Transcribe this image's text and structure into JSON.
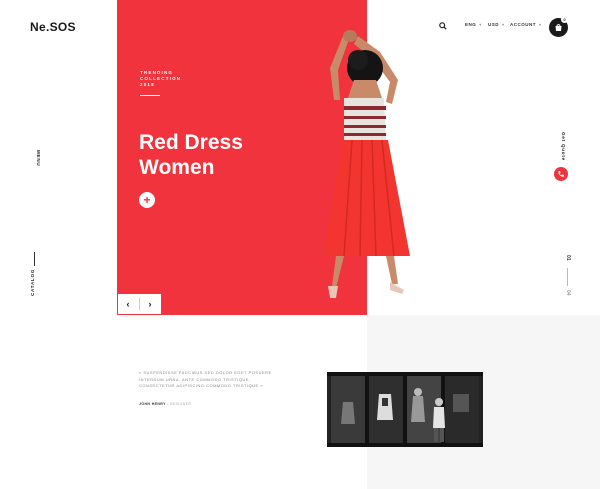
{
  "brand": {
    "logo": "Ne.SOS"
  },
  "header": {
    "nav": [
      {
        "label": "ENG"
      },
      {
        "label": "USD"
      },
      {
        "label": "ACCOUNT"
      }
    ],
    "cart_count": "0"
  },
  "hero": {
    "eyebrow_line1": "TRENDING",
    "eyebrow_line2": "COLLECTION",
    "eyebrow_line3": "2018",
    "title_line1": "Red Dress",
    "title_line2": "Women",
    "plus_label": "+",
    "prev_label": "‹",
    "next_label": "›"
  },
  "sidebar_left": {
    "menu_label": "MENU",
    "catalog_label": "CATALOG"
  },
  "sidebar_right": {
    "contact_label": "Get Quote",
    "slide_current": "01",
    "slide_total": "04"
  },
  "testimonial": {
    "quote": "« SUSPENDISSE FAUCIBUS SED DOLOR EGET POSUERE INTERDUM URNA. ANTE COMMODO TRISTIQUE, CONSECTETUR ADIPISCING COMMODO TRISTIQUE »",
    "author": "JOHN HENRY",
    "author_role": "/ DESIGNER"
  },
  "colors": {
    "accent": "#f0333d",
    "dark": "#1a1a1a",
    "panel": "#f6f6f6"
  },
  "icons": [
    "search-icon",
    "cart-icon",
    "phone-icon",
    "plus-icon",
    "arrow-left-icon",
    "arrow-right-icon"
  ]
}
